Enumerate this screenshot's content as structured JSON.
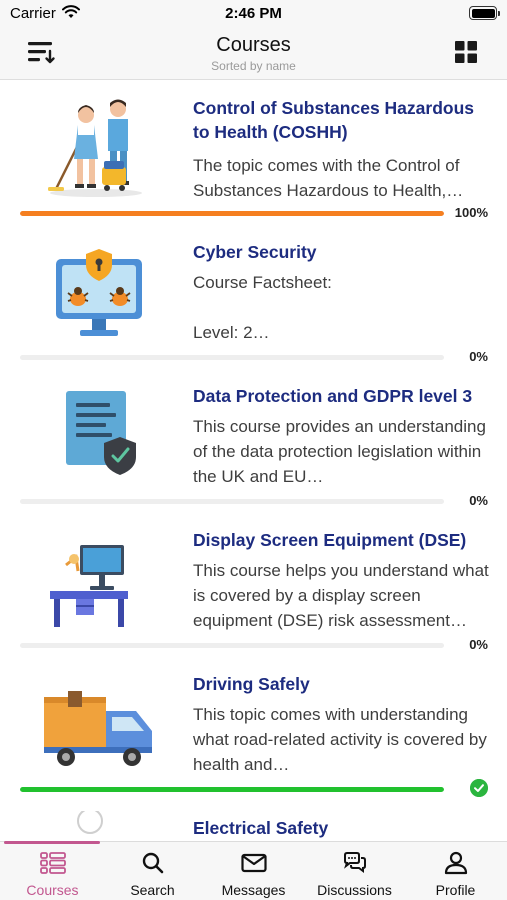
{
  "status": {
    "carrier": "Carrier",
    "time": "2:46 PM"
  },
  "nav": {
    "title": "Courses",
    "subtitle": "Sorted by name",
    "sort_icon": "sort-list-icon",
    "grid_icon": "grid-view-icon"
  },
  "colors": {
    "title": "#1d2c80",
    "progress_orange": "#f57f20",
    "progress_green": "#21c12e",
    "accent": "#c2578f",
    "complete": "#2bb53f"
  },
  "courses": [
    {
      "title": "Control of Substances Hazardous to Health (COSHH)",
      "description": "The topic comes with the Control of Substances Hazardous to Health,…",
      "progress_label": "100%",
      "progress": 1.0
    },
    {
      "title": "Cyber Security",
      "description": "Course Factsheet:\n\nLevel: 2…",
      "progress_label": "0%",
      "progress": 0
    },
    {
      "title": "Data Protection and GDPR level 3",
      "description": "This course provides an understanding of the data protection legislation within the UK and EU…",
      "progress_label": "0%",
      "progress": 0
    },
    {
      "title": "Display Screen Equipment (DSE)",
      "description": "This course helps you understand what is covered by a display screen equipment (DSE) risk assessment…",
      "progress_label": "0%",
      "progress": 0
    },
    {
      "title": "Driving Safely",
      "description": "This topic comes with understanding what road-related activity is covered by health and…",
      "progress": 1.0,
      "status": "completed"
    },
    {
      "title": "Electrical Safety"
    }
  ],
  "tabs": [
    {
      "label": "Courses",
      "icon": "courses-list-icon",
      "active": true
    },
    {
      "label": "Search",
      "icon": "search-icon"
    },
    {
      "label": "Messages",
      "icon": "envelope-icon"
    },
    {
      "label": "Discussions",
      "icon": "chat-bubbles-icon"
    },
    {
      "label": "Profile",
      "icon": "person-icon"
    }
  ]
}
